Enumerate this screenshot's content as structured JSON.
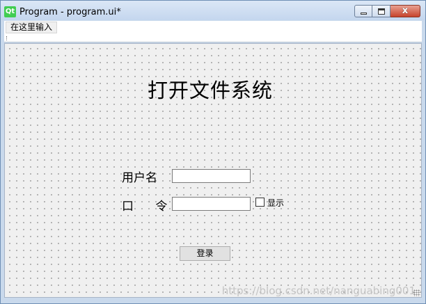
{
  "window": {
    "icon_text": "Qt",
    "title": "Program - program.ui*",
    "close_glyph": "x"
  },
  "menubar": {
    "item_label": "在这里输入"
  },
  "form": {
    "title": "打开文件系统",
    "username_label": "用户名",
    "password_label": "口 令",
    "username_value": "",
    "password_value": "",
    "show_label": "显示",
    "login_label": "登录"
  },
  "watermark": {
    "text": "https://blog.csdn.net/nanguabing001"
  },
  "colors": {
    "titlebar": "#c9d9ec",
    "canvas": "#f0f0f0",
    "close_button": "#c7432c",
    "qt_icon": "#41cd52"
  }
}
